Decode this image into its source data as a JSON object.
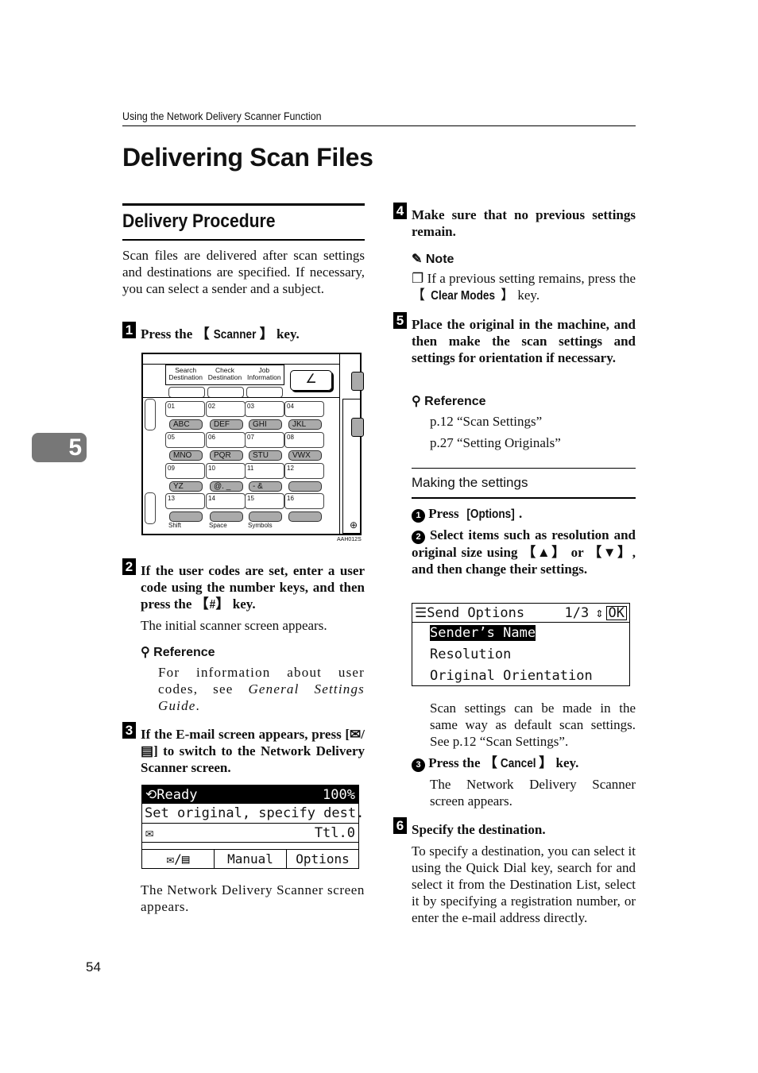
{
  "running_head": "Using the Network Delivery Scanner Function",
  "page_title": "Delivering Scan Files",
  "chapter_tab": "5",
  "page_number": "54",
  "section": {
    "title": "Delivery Procedure",
    "intro": "Scan files are delivered after scan settings and destinations are specified. If necessary, you can select a sender and a subject."
  },
  "steps": [
    {
      "num": "1",
      "pre": "Press the ",
      "key": "Scanner",
      "post": " key."
    },
    {
      "num": "2",
      "text_a": "If the user codes are set, enter a user code using the number keys, and then press the ",
      "key": "#",
      "post": " key.",
      "body": "The initial scanner screen appears.",
      "reference_label": "Reference",
      "reference_text": "For information about user codes, see ",
      "reference_italic": "General Settings Guide",
      "reference_end": "."
    },
    {
      "num": "3",
      "text": "If the E-mail screen appears, press [",
      "text_b": "] to switch to the Network Delivery Scanner screen.",
      "body": "The Network Delivery Scanner screen appears."
    },
    {
      "num": "4",
      "text": "Make sure that no previous settings remain.",
      "note_label": "Note",
      "note_pre": "If a previous setting remains, press the ",
      "note_key": "Clear Modes",
      "note_post": " key."
    },
    {
      "num": "5",
      "text": "Place the original in the machine, and then make the scan settings and settings for orientation if necessary.",
      "reference_label": "Reference",
      "refs": [
        "p.12 “Scan Settings”",
        "p.27 “Setting Originals”"
      ]
    },
    {
      "num": "6",
      "text": "Specify the destination.",
      "body": "To specify a destination, you can select it using the Quick Dial key, search for and select it from the Destination List, select it by specifying a registration number, or enter the e-mail address directly."
    }
  ],
  "making_settings": {
    "title": "Making the settings",
    "items": [
      {
        "num": "1",
        "pre": "Press ",
        "key": "[Options]",
        "post": "."
      },
      {
        "num": "2",
        "text": "Select items such as resolution and original size using 【▲】 or 【▼】, and then change their settings."
      },
      {
        "num": "3",
        "pre": "Press the ",
        "key": "Cancel",
        "post": " key.",
        "body": "The Network Delivery Scanner screen appears."
      }
    ],
    "after_lcd": "Scan settings can be made in the same way as default scan settings. See p.12 “Scan Settings”."
  },
  "control_panel": {
    "top_buttons": [
      "Search\nDestination",
      "Check\nDestination",
      "Job\nInformation"
    ],
    "numbers": [
      "01",
      "02",
      "03",
      "04",
      "05",
      "06",
      "07",
      "08",
      "09",
      "10",
      "11",
      "12",
      "13",
      "14",
      "15",
      "16"
    ],
    "letter_keys": [
      "ABC",
      "DEF",
      "GHI",
      "JKL",
      "MNO",
      "PQR",
      "STU",
      "VWX",
      "YZ",
      "@. _",
      "- &",
      ""
    ],
    "bottom_labels": [
      "Shift",
      "Space",
      "Symbols",
      ""
    ],
    "figure_code": "AAH012S"
  },
  "lcd_ready": {
    "status": "Ready",
    "percent": "100%",
    "message": "Set original, specify dest.",
    "total": "Ttl.0",
    "buttons": [
      "",
      "Manual",
      "Options"
    ]
  },
  "lcd_options": {
    "title": "Send Options",
    "page": "1/3",
    "ok": "OK",
    "items": [
      "Sender’s Name",
      "Resolution",
      "Original Orientation"
    ],
    "selected_index": 0
  }
}
